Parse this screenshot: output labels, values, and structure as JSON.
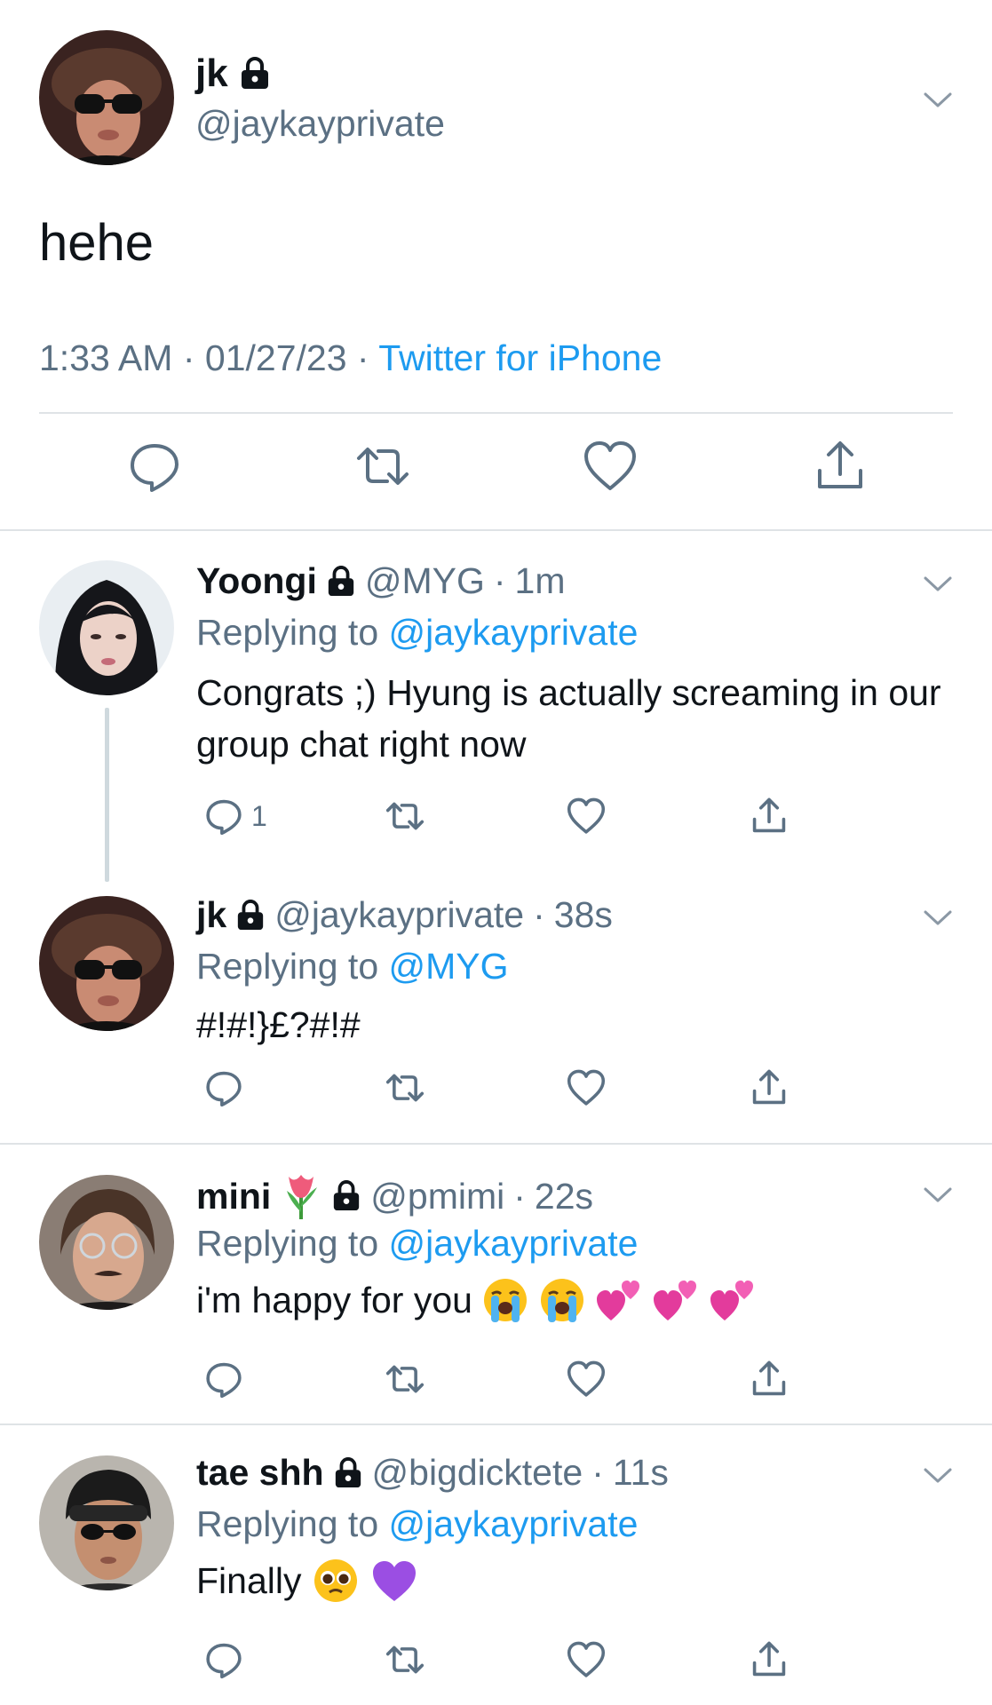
{
  "main_tweet": {
    "display_name": "jk",
    "handle": "@jaykayprivate",
    "text": "hehe",
    "time": "1:33 AM",
    "date": "01/27/23",
    "source": "Twitter for iPhone",
    "sep": "·"
  },
  "replies": [
    {
      "display_name": "Yoongi",
      "handle": "@MYG",
      "time": "1m",
      "replying_label": "Replying to",
      "replying_to": "@jaykayprivate",
      "text": "Congrats ;) Hyung is actually screaming in our group chat right now",
      "reply_count": "1"
    },
    {
      "display_name": "jk",
      "handle": "@jaykayprivate",
      "time": "38s",
      "replying_label": "Replying to",
      "replying_to": "@MYG",
      "text": "#!#!}£?#!#"
    },
    {
      "display_name": "mini",
      "name_emoji": "tulip",
      "handle": "@pmimi",
      "time": "22s",
      "replying_label": "Replying to",
      "replying_to": "@jaykayprivate",
      "text": "i'm happy for you",
      "emojis": [
        "loudly-crying-face",
        "loudly-crying-face",
        "two-hearts",
        "two-hearts",
        "two-hearts"
      ]
    },
    {
      "display_name": "tae shh",
      "handle": "@bigdicktete",
      "time": "11s",
      "replying_label": "Replying to",
      "replying_to": "@jaykayprivate",
      "text": "Finally",
      "emojis": [
        "pleading-face",
        "purple-heart"
      ]
    }
  ],
  "colors": {
    "link": "#1d9bf0",
    "secondary": "#5b7083",
    "divider": "#dfe3e6",
    "thread_line": "#cfd9de"
  }
}
